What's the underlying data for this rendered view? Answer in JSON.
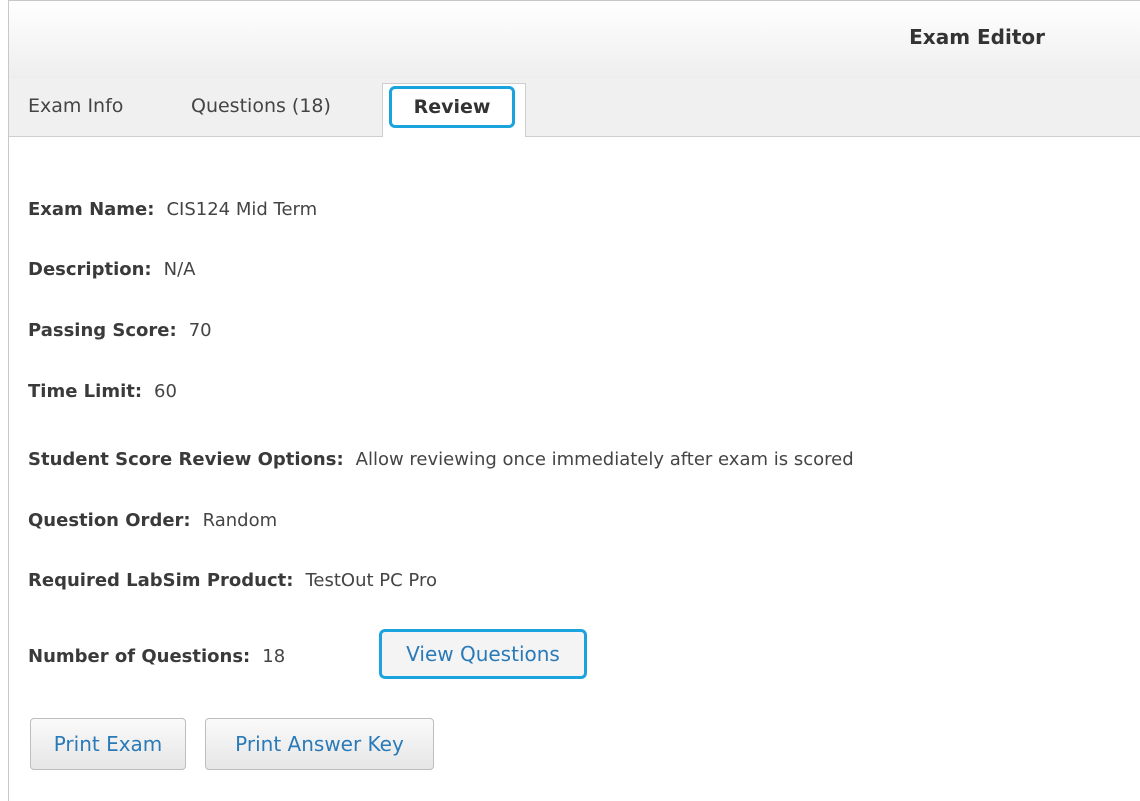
{
  "header": {
    "title": "Exam Editor"
  },
  "tabs": [
    {
      "label": "Exam Info"
    },
    {
      "label": "Questions (18)"
    },
    {
      "label": "Review",
      "active": true
    }
  ],
  "review": {
    "exam_name": {
      "label": "Exam Name:",
      "value": "CIS124 Mid Term"
    },
    "description": {
      "label": "Description:",
      "value": "N/A"
    },
    "passing_score": {
      "label": "Passing Score:",
      "value": "70"
    },
    "time_limit": {
      "label": "Time Limit:",
      "value": "60"
    },
    "score_review": {
      "label": "Student Score Review Options:",
      "value": "Allow reviewing once immediately after exam is scored"
    },
    "question_order": {
      "label": "Question Order:",
      "value": "Random"
    },
    "required_product": {
      "label": "Required LabSim Product:",
      "value": "TestOut PC Pro"
    },
    "num_questions": {
      "label": "Number of Questions:",
      "value": "18"
    },
    "view_questions_label": "View Questions"
  },
  "buttons": {
    "print_exam": "Print Exam",
    "print_answer_key": "Print Answer Key"
  },
  "colors": {
    "highlight": "#1aa3dc",
    "link": "#2a7ab8"
  }
}
